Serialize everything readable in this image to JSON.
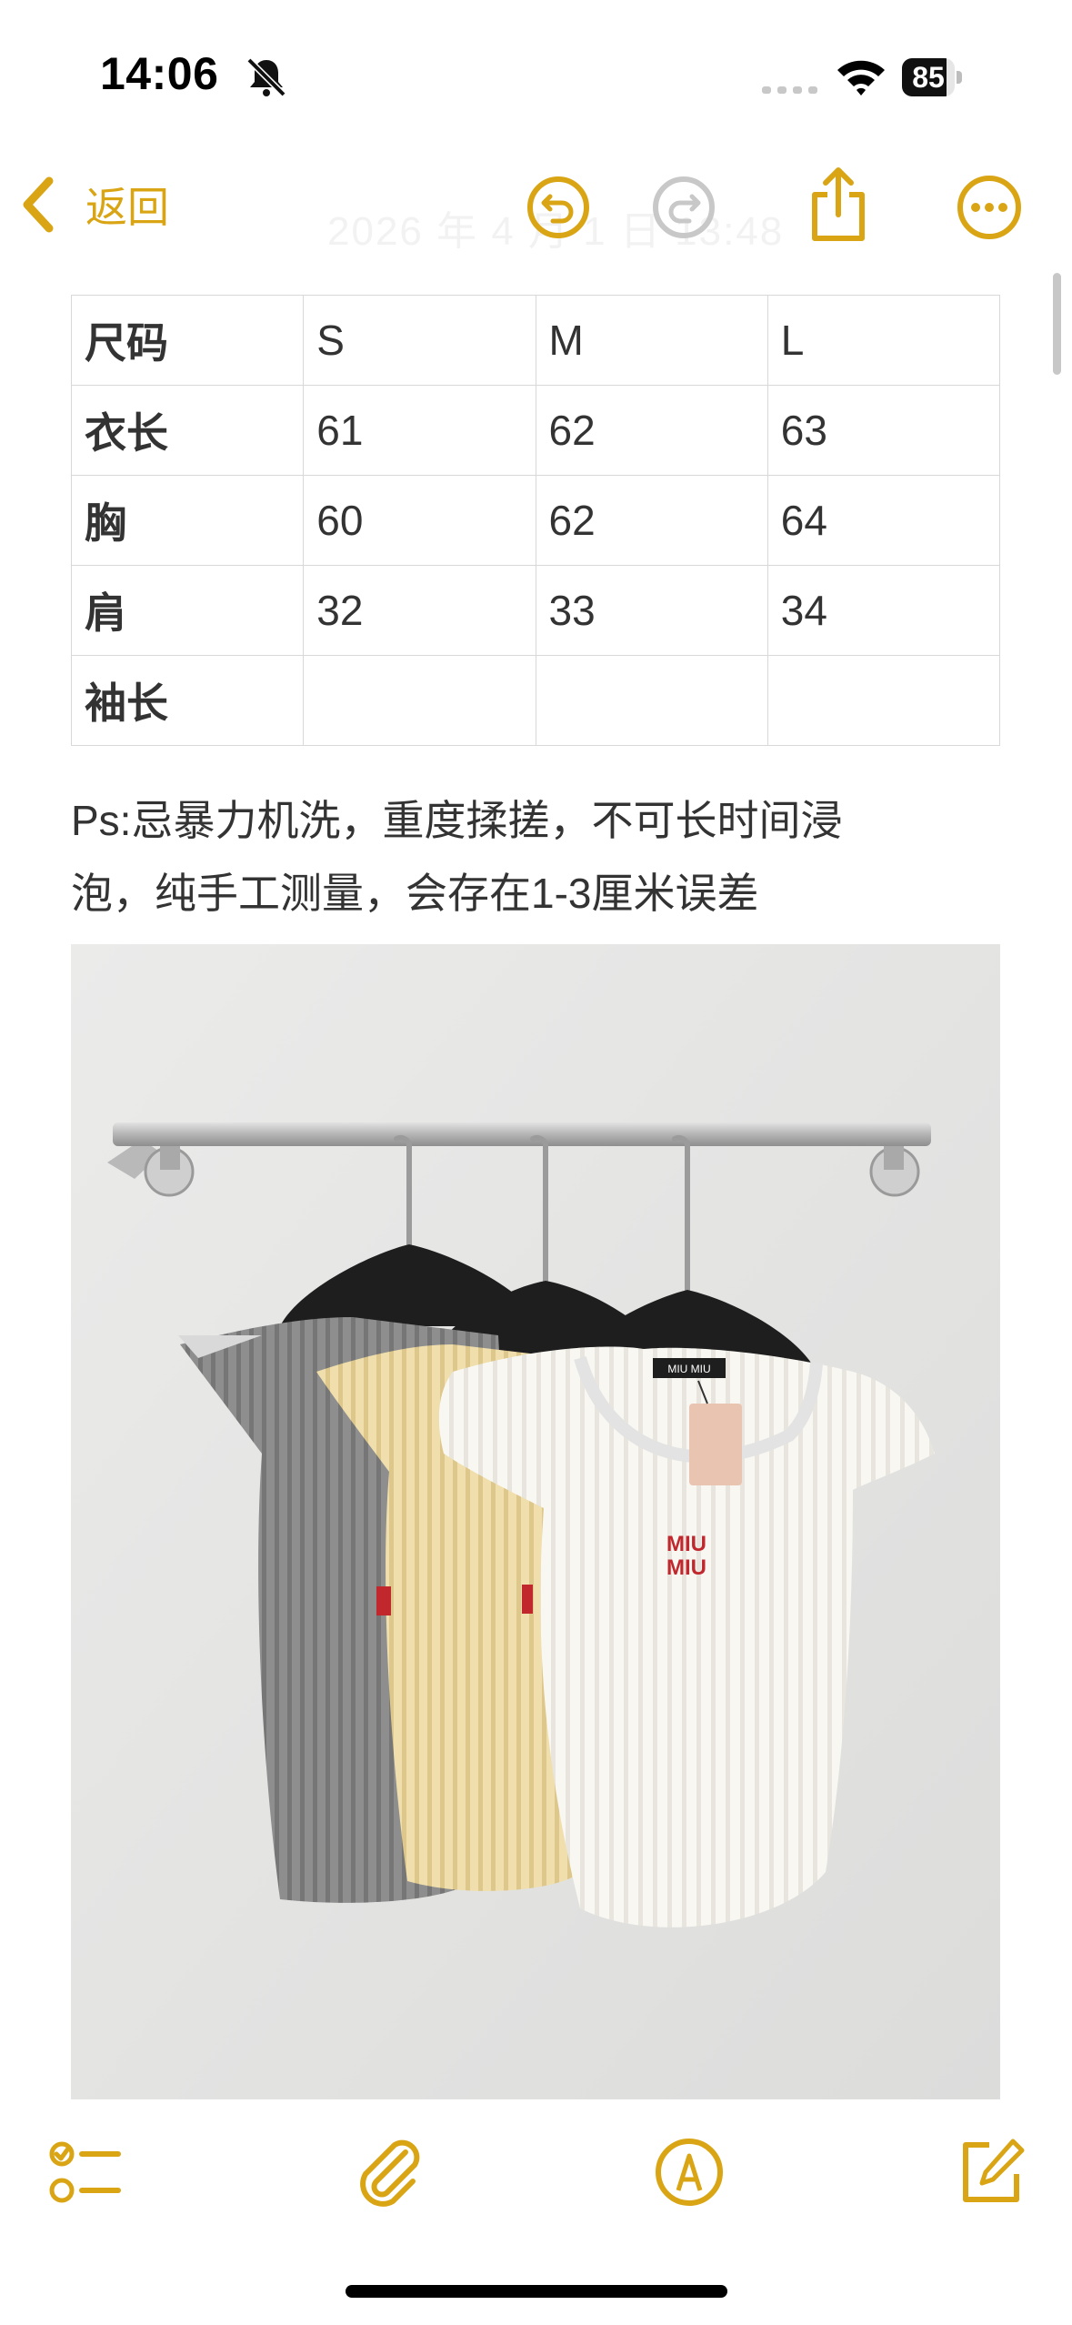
{
  "status_bar": {
    "time": "14:06",
    "battery_level": "85",
    "battery_fraction": 0.85
  },
  "nav": {
    "back_label": "返回",
    "faint_title": "2026 年 4 月 1 日 13:48"
  },
  "size_table": {
    "header": [
      "尺码",
      "S",
      "M",
      "L"
    ],
    "rows": [
      [
        "衣长",
        "61",
        "62",
        "63"
      ],
      [
        "胸",
        "60",
        "62",
        "64"
      ],
      [
        "肩",
        "32",
        "33",
        "34"
      ],
      [
        "袖长",
        "",
        "",
        ""
      ]
    ]
  },
  "note": {
    "line1": "Ps:忌暴力机洗，重度揉搓，不可长时间浸",
    "line2": "泡，纯手工测量，会存在1-3厘米误差"
  },
  "photo": {
    "label_text": "MIU MIU",
    "logo_line1": "MIU",
    "logo_line2": "MIU"
  },
  "colors": {
    "accent": "#d9a514",
    "disabled": "#c8c8c8",
    "logo_red": "#c0282d",
    "shirt_gray": "#8c8c8c",
    "shirt_yellow": "#f0dfac",
    "shirt_white": "#f7f6f1"
  },
  "icons": {
    "status": [
      "bell-slash-icon",
      "cellular-signal-icon",
      "wifi-icon",
      "battery-icon"
    ],
    "nav": [
      "chevron-left-icon",
      "undo-icon",
      "redo-icon",
      "share-icon",
      "more-icon"
    ],
    "toolbar": [
      "checklist-icon",
      "paperclip-icon",
      "markup-pen-icon",
      "compose-icon"
    ]
  }
}
